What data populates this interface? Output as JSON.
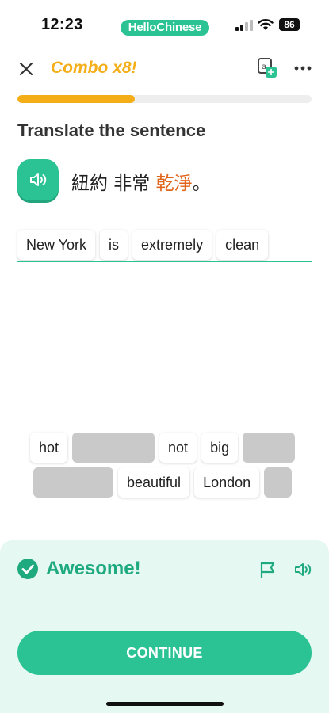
{
  "status_bar": {
    "time": "12:23",
    "brand": "HelloChinese",
    "battery": "86"
  },
  "header": {
    "combo": "Combo x8!"
  },
  "progress": {
    "fraction": 0.4,
    "fill_color": "#f4ae17"
  },
  "prompt": {
    "title": "Translate the sentence",
    "sentence_start": "紐約 非常 ",
    "sentence_highlight": "乾淨",
    "sentence_end": "。"
  },
  "answer": {
    "words": [
      "New York",
      "is",
      "extremely",
      "clean"
    ]
  },
  "word_bank": {
    "row1": {
      "word1": "hot",
      "word2": "not",
      "word3": "big"
    },
    "row2": {
      "word1": "beautiful",
      "word2": "London"
    }
  },
  "feedback": {
    "message": "Awesome!",
    "continue_label": "CONTINUE"
  },
  "colors": {
    "accent": "#2cc394",
    "combo": "#f4ae17",
    "highlight": "#e0651c",
    "feedback_bg": "#e5f8f2"
  },
  "icons": [
    "close-icon",
    "translate-icon",
    "more-icon",
    "speaker-icon",
    "check-icon",
    "flag-icon"
  ]
}
